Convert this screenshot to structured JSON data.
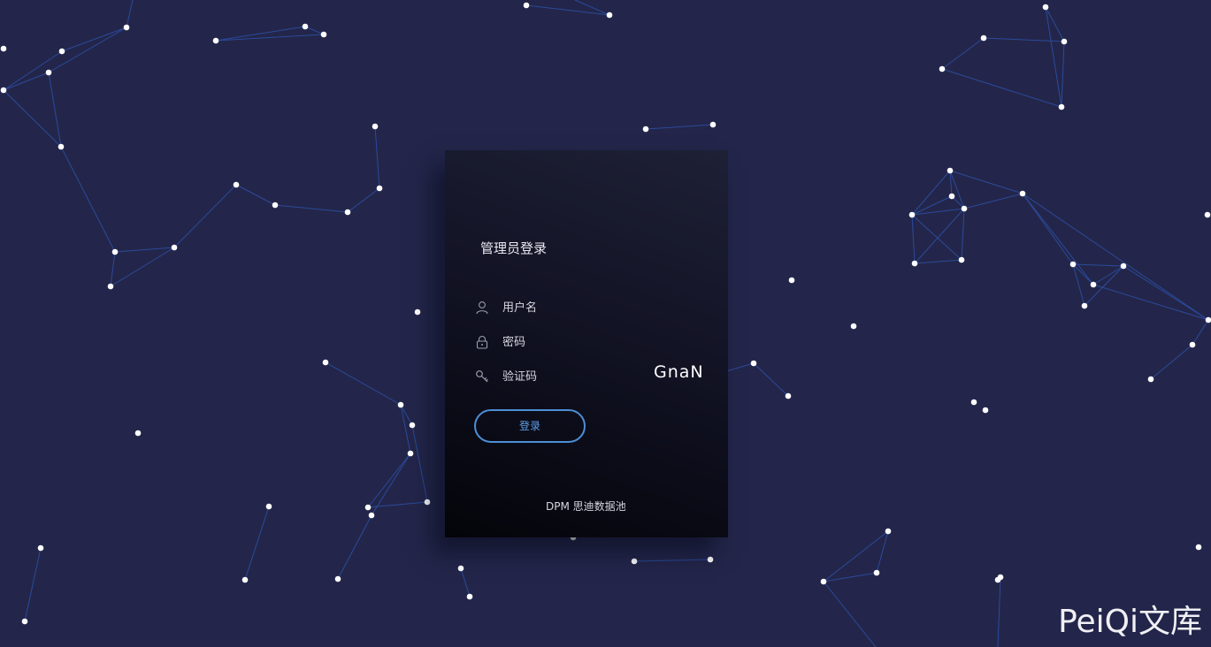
{
  "login": {
    "title": "管理员登录",
    "username_placeholder": "用户名",
    "password_placeholder": "密码",
    "captcha_placeholder": "验证码",
    "captcha_text": "GnaN",
    "submit_label": "登录",
    "footer": "DPM 思迪数据池"
  },
  "watermark": {
    "text": "PeiQi文库"
  },
  "icons": {
    "username": "user-icon",
    "password": "lock-icon",
    "captcha": "key-icon"
  },
  "colors": {
    "background": "#23264a",
    "particle": "#ffffff",
    "particle_line": "#2b4a9a",
    "button_border": "#4c8fd6",
    "button_text": "#5fa0e8"
  }
}
